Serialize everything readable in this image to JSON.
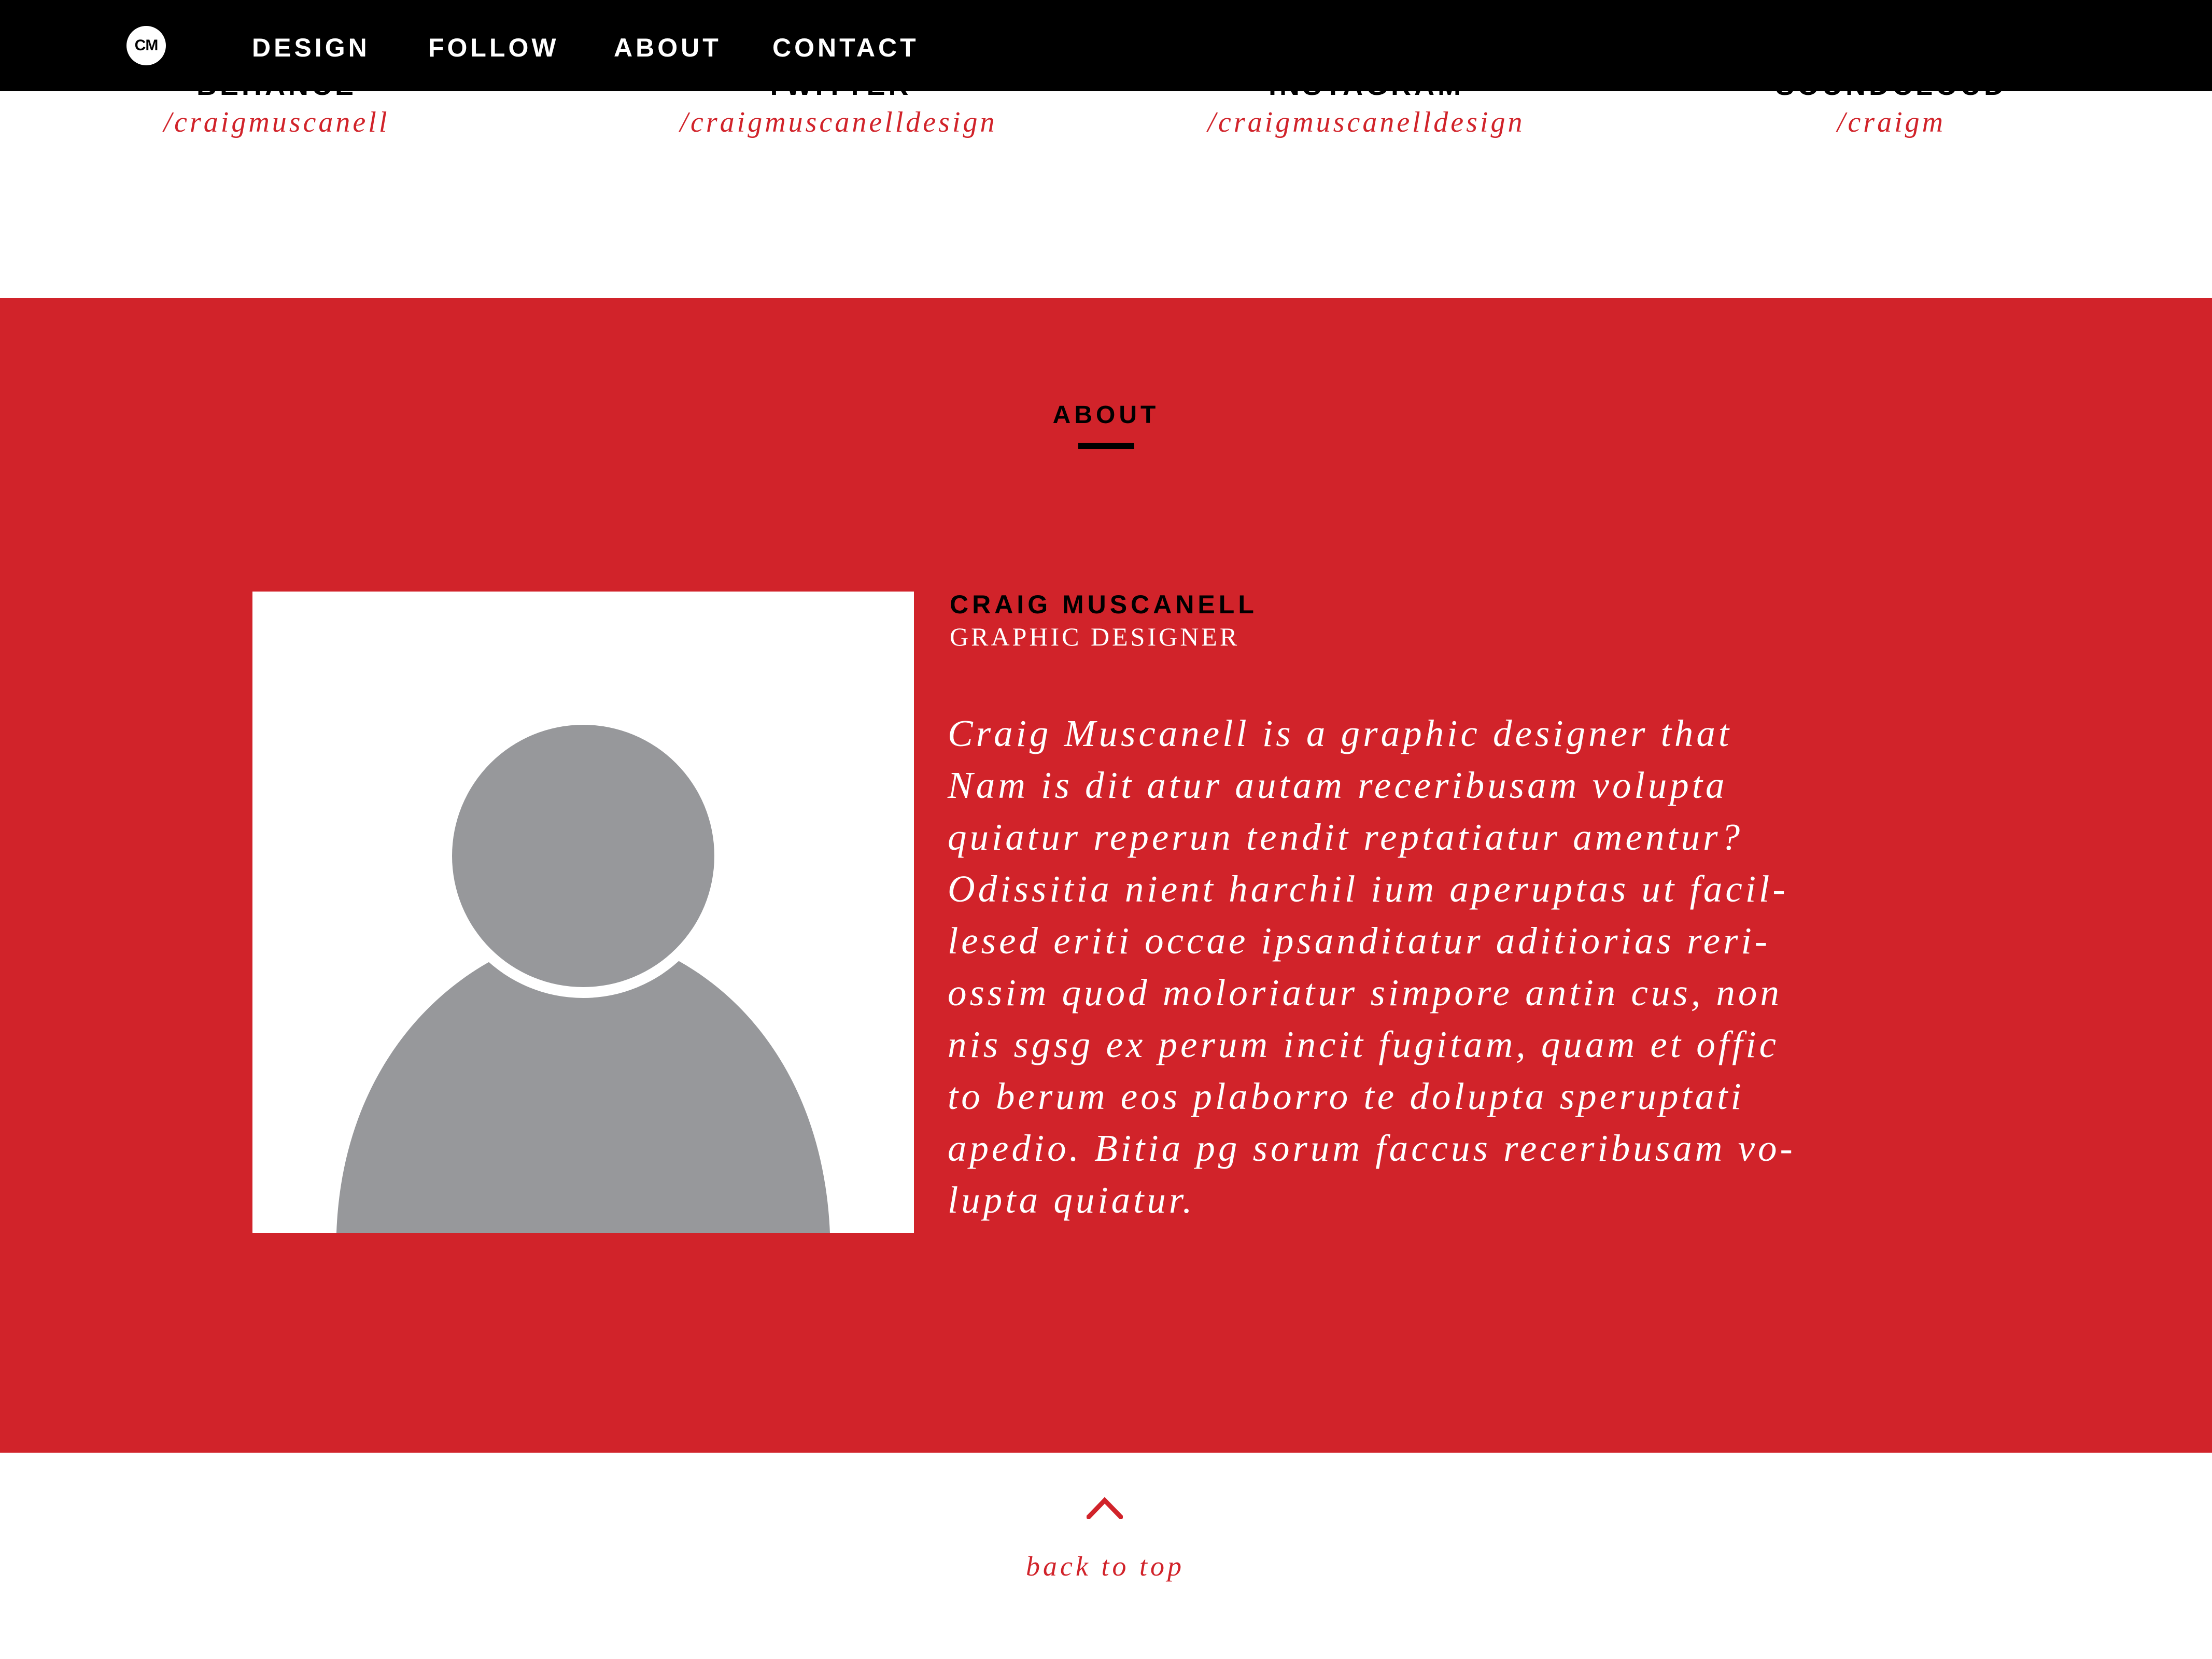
{
  "colors": {
    "accent": "#d1232a",
    "navbar": "#000000",
    "avatar_gray": "#97989b",
    "text_dark": "#000000",
    "text_light": "#ffffff"
  },
  "nav": {
    "logo_text": "CM",
    "items": [
      {
        "label": "DESIGN"
      },
      {
        "label": "FOLLOW"
      },
      {
        "label": "ABOUT"
      },
      {
        "label": "CONTACT"
      }
    ]
  },
  "follow": {
    "items": [
      {
        "name": "BEHANCE",
        "handle": "/craigmuscanell"
      },
      {
        "name": "TWITTER",
        "handle": "/craigmuscanelldesign"
      },
      {
        "name": "INSTAGRAM",
        "handle": "/craigmuscanelldesign"
      },
      {
        "name": "SOUNDCLOUD",
        "handle": "/craigm"
      }
    ]
  },
  "about": {
    "heading": "ABOUT",
    "photo_icon": "person-silhouette-icon",
    "name": "CRAIG MUSCANELL",
    "role": "GRAPHIC DESIGNER",
    "bio_lines": [
      "Craig Muscanell is a graphic designer that",
      "Nam is dit atur autam receribusam volupta",
      "quiatur reperun tendit reptatiatur amentur?",
      "Odissitia nient harchil ium aperuptas ut facil-",
      "lesed eriti occae ipsanditatur aditiorias reri-",
      "ossim quod moloriatur simpore antin cus, non",
      "nis sgsg ex perum incit fugitam, quam et offic",
      "to berum eos plaborro te dolupta speruptati",
      "apedio. Bitia pg sorum faccus receribusam vo-",
      "lupta quiatur."
    ]
  },
  "footer": {
    "back_to_top_icon": "chevron-up-icon",
    "back_to_top_label": "back to top"
  }
}
